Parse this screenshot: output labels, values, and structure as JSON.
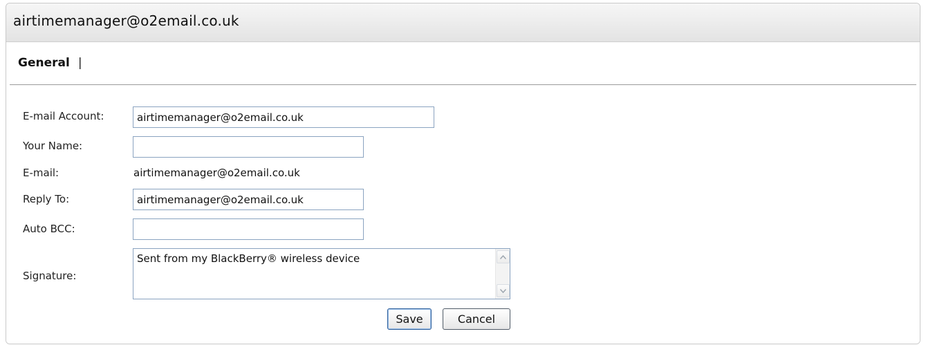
{
  "window": {
    "title": "airtimemanager@o2email.co.uk"
  },
  "tabs": {
    "general_label": "General",
    "separator": "|"
  },
  "form": {
    "email_account": {
      "label": "E-mail Account:",
      "value": "airtimemanager@o2email.co.uk"
    },
    "your_name": {
      "label": "Your Name:",
      "value": ""
    },
    "email": {
      "label": "E-mail:",
      "value": "airtimemanager@o2email.co.uk"
    },
    "reply_to": {
      "label": "Reply To:",
      "value": "airtimemanager@o2email.co.uk"
    },
    "auto_bcc": {
      "label": "Auto BCC:",
      "value": ""
    },
    "signature": {
      "label": "Signature:",
      "value": "Sent from my BlackBerry® wireless device"
    }
  },
  "buttons": {
    "save_label": "Save",
    "cancel_label": "Cancel"
  },
  "icons": {
    "scroll_up": "chevron-up-icon",
    "scroll_down": "chevron-down-icon"
  },
  "colors": {
    "field_border": "#8aa3c0",
    "save_border": "#2f5f9a"
  }
}
